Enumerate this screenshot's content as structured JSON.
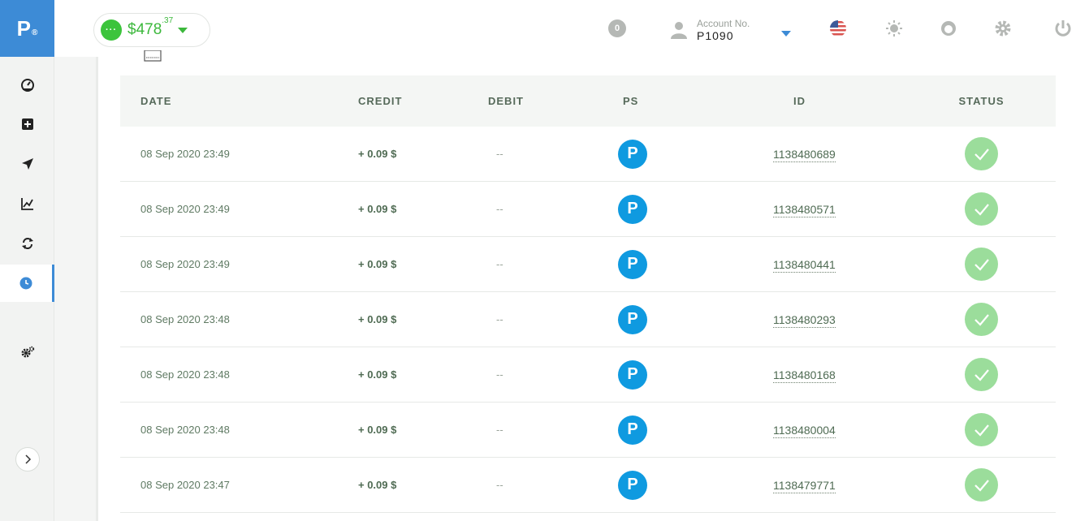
{
  "logo": {
    "letter": "P",
    "mark": "®"
  },
  "sidebar": {
    "items": [
      {
        "name": "dashboard",
        "icon": "speedometer-icon"
      },
      {
        "name": "add-funds",
        "icon": "plus-square-icon"
      },
      {
        "name": "send",
        "icon": "paper-plane-icon"
      },
      {
        "name": "statistics",
        "icon": "chart-line-icon"
      },
      {
        "name": "exchange",
        "icon": "refresh-icon"
      },
      {
        "name": "history",
        "icon": "clock-icon",
        "active": true
      },
      {
        "name": "settings",
        "icon": "gears-icon"
      }
    ]
  },
  "header": {
    "balance_dots": "···",
    "balance_main": "$478",
    "balance_cents": ".37",
    "notifications": "0",
    "account_label": "Account No.",
    "account_number": "P1090"
  },
  "table": {
    "headers": {
      "date": "DATE",
      "credit": "CREDIT",
      "debit": "DEBIT",
      "ps": "PS",
      "id": "ID",
      "status": "STATUS"
    },
    "rows": [
      {
        "date": "08 Sep 2020 23:49",
        "credit": "+ 0.09 $",
        "debit": "--",
        "ps": "P",
        "id": "1138480689"
      },
      {
        "date": "08 Sep 2020 23:49",
        "credit": "+ 0.09 $",
        "debit": "--",
        "ps": "P",
        "id": "1138480571"
      },
      {
        "date": "08 Sep 2020 23:49",
        "credit": "+ 0.09 $",
        "debit": "--",
        "ps": "P",
        "id": "1138480441"
      },
      {
        "date": "08 Sep 2020 23:48",
        "credit": "+ 0.09 $",
        "debit": "--",
        "ps": "P",
        "id": "1138480293"
      },
      {
        "date": "08 Sep 2020 23:48",
        "credit": "+ 0.09 $",
        "debit": "--",
        "ps": "P",
        "id": "1138480168"
      },
      {
        "date": "08 Sep 2020 23:48",
        "credit": "+ 0.09 $",
        "debit": "--",
        "ps": "P",
        "id": "1138480004"
      },
      {
        "date": "08 Sep 2020 23:47",
        "credit": "+ 0.09 $",
        "debit": "--",
        "ps": "P",
        "id": "1138479771"
      }
    ]
  },
  "colors": {
    "brand": "#3d8bd6",
    "balance_green": "#3cc43c",
    "ps_blue": "#0f9ae0",
    "status_green": "#9bdd9b"
  }
}
